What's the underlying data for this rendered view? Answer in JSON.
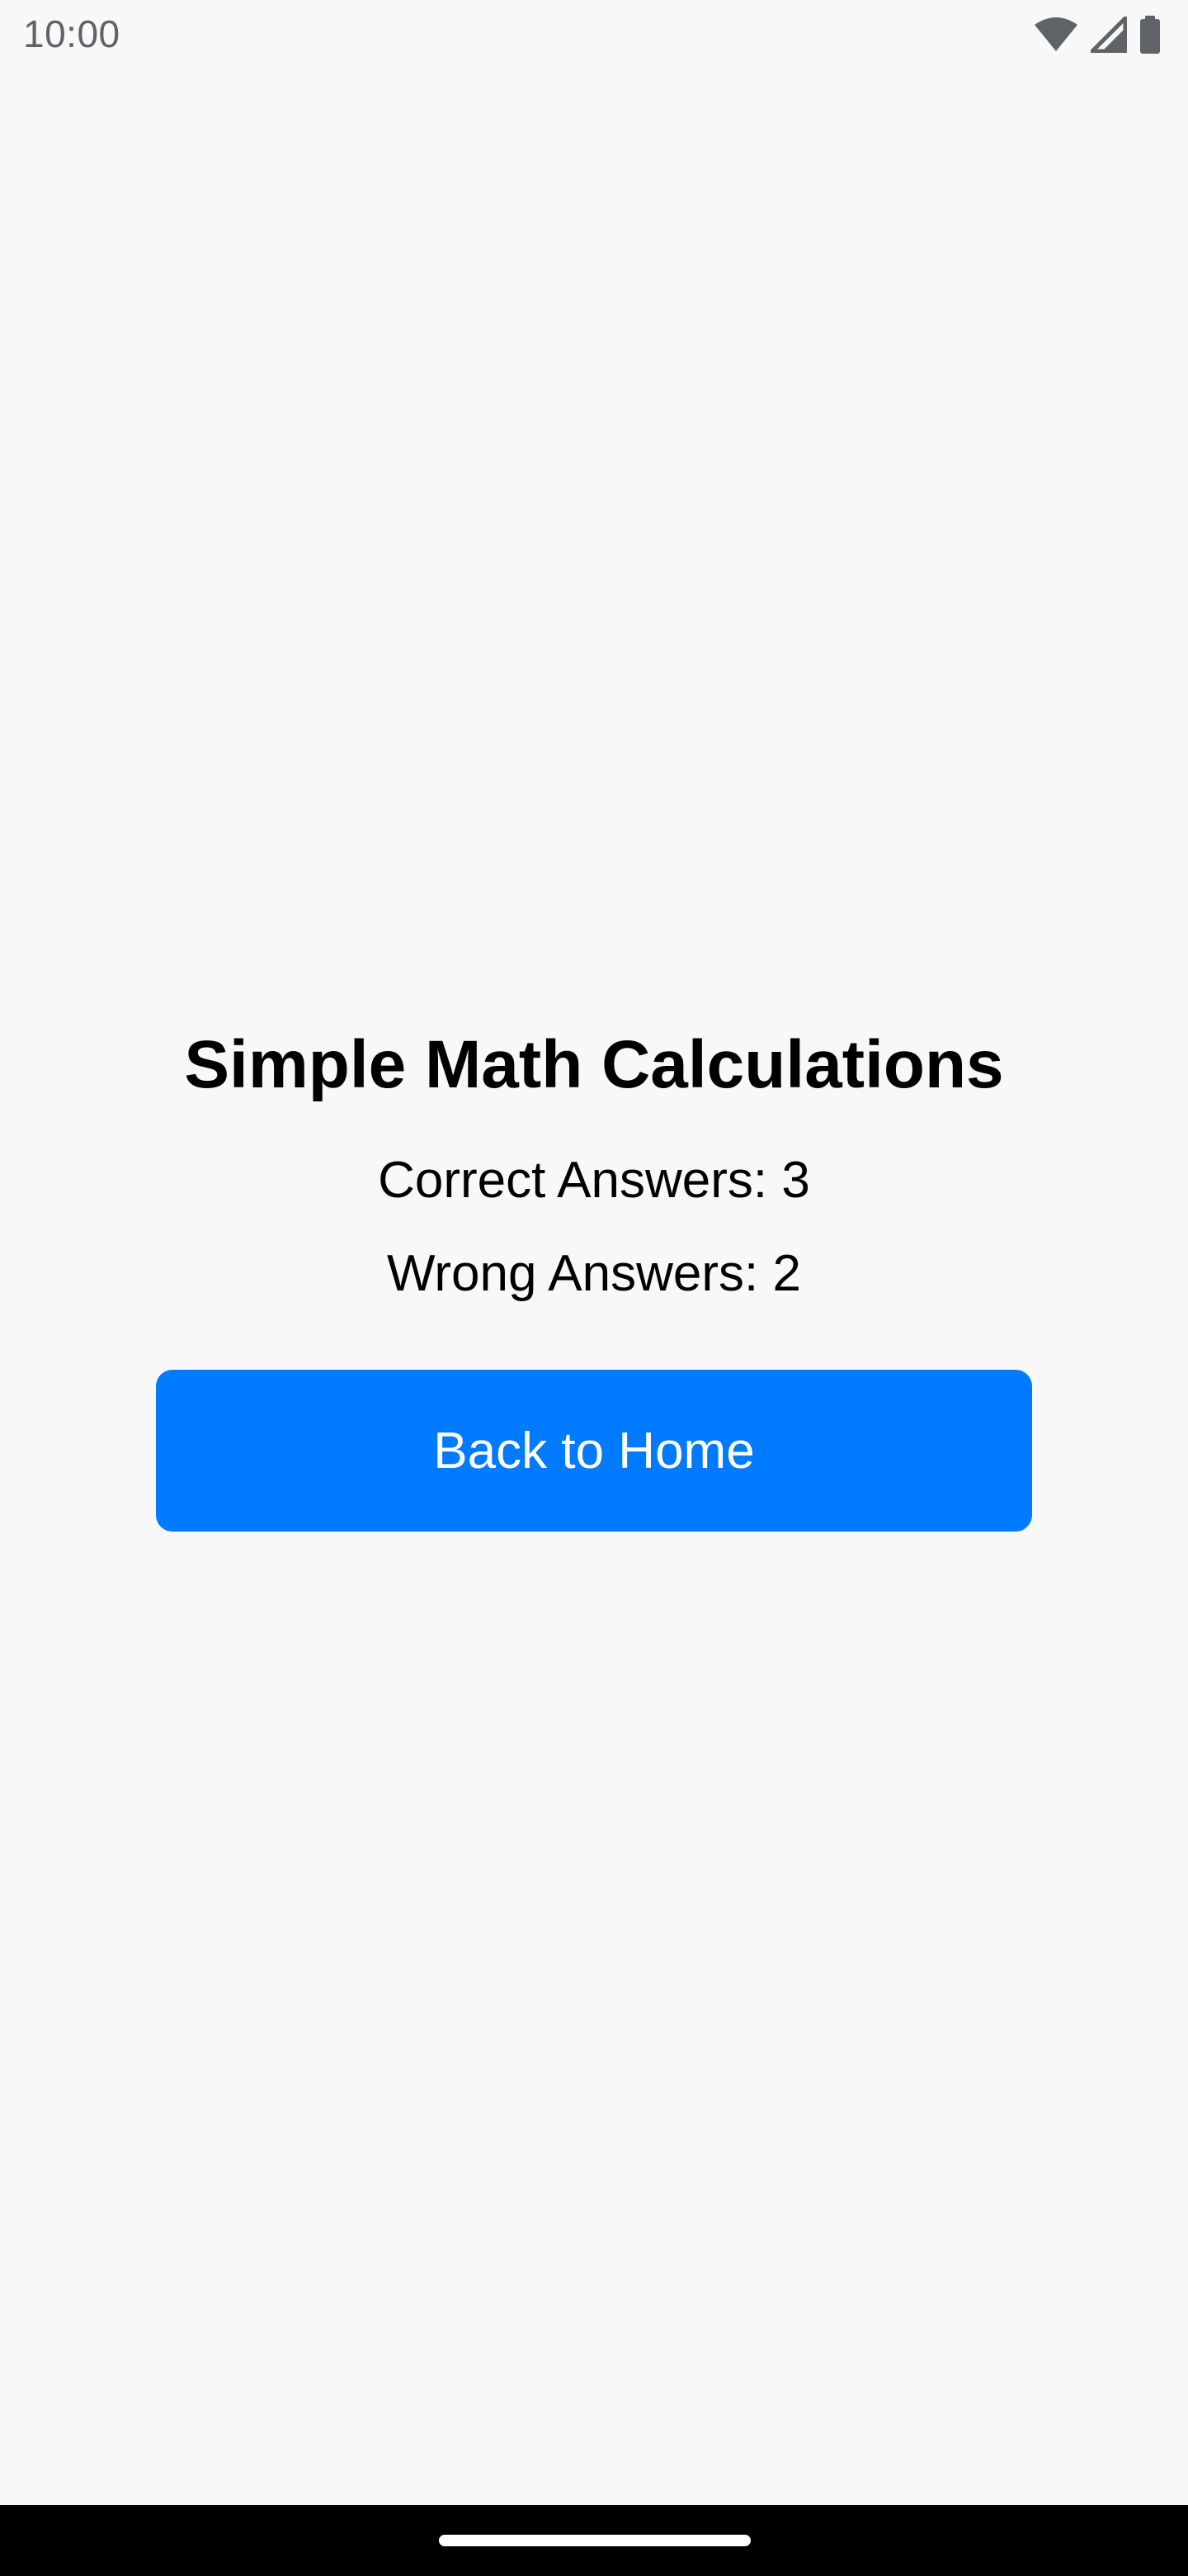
{
  "status_bar": {
    "time": "10:00",
    "icons": [
      "wifi-icon",
      "cellular-signal-icon",
      "battery-icon"
    ]
  },
  "main": {
    "title": "Simple Math Calculations",
    "correct_label": "Correct Answers: 3",
    "wrong_label": "Wrong Answers: 2",
    "back_button_label": "Back to Home"
  },
  "colors": {
    "background": "#f8f8f9",
    "accent": "#007aff",
    "nav_bar": "#000000"
  }
}
